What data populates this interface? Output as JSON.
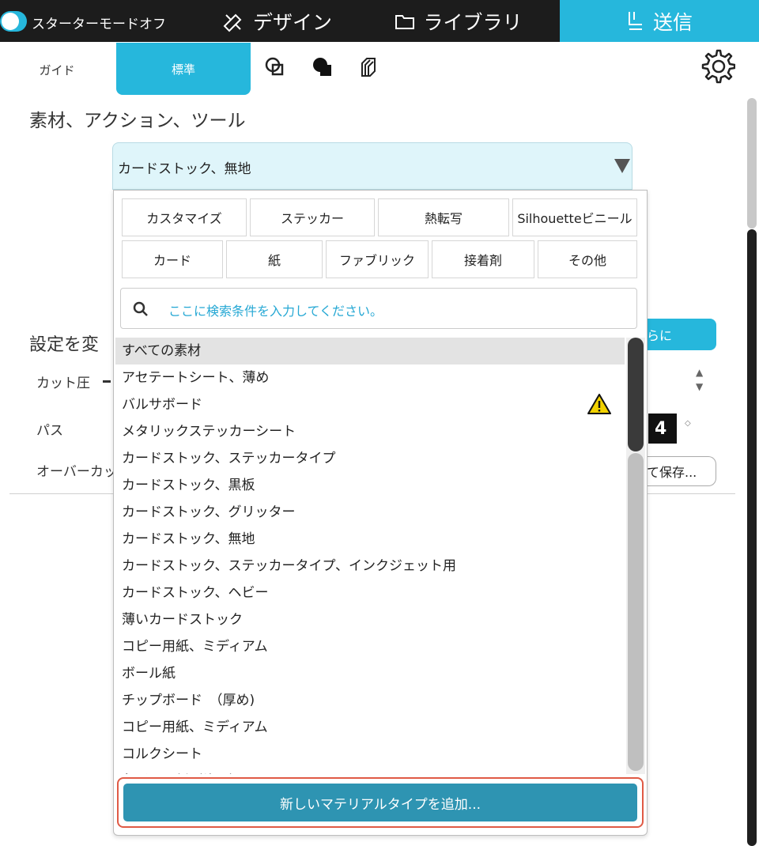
{
  "topbar": {
    "starter_label": "スターターモードオフ",
    "tab_design": "デザイン",
    "tab_library": "ライブラリ",
    "tab_send": "送信"
  },
  "subtabs": {
    "guide": "ガイド",
    "standard": "標準"
  },
  "section_title": "素材、アクション、ツール",
  "material_select": {
    "value": "カードストック、無地"
  },
  "background_panel": {
    "settings_label": "設定を変",
    "cut_pressure": "カット圧",
    "pass": "パス",
    "overcut": "オーバーカット",
    "further_button": "らに",
    "pass_value": "4",
    "save_button": "て保存..."
  },
  "dropdown": {
    "categories_row1": [
      "カスタマイズ",
      "ステッカー",
      "熱転写",
      "Silhouetteビニール"
    ],
    "categories_row2": [
      "カード",
      "紙",
      "ファブリック",
      "接着剤",
      "その他"
    ],
    "search_placeholder": "ここに検索条件を入力してください。",
    "items": [
      "すべての素材",
      "アセテートシート、薄め",
      "バルサボード",
      "メタリックステッカーシート",
      "カードストック、ステッカータイプ",
      "カードストック、黒板",
      "カードストック、グリッター",
      "カードストック、無地",
      "カードストック、ステッカータイプ、インクジェット用",
      "カードストック、ヘビー",
      "薄いカードストック",
      "コピー用紙、ミディアム",
      "ボール紙",
      "チップボード　（厚め)",
      "コピー用紙、ミディアム",
      "コルクシート",
      "段ボール紙（片面）"
    ],
    "add_button": "新しいマテリアルタイプを追加..."
  },
  "colors": {
    "accent": "#26b7dc",
    "topbar_bg": "#1c1c1c",
    "add_button_bg": "#2e94b2",
    "highlight_border": "#e05a45"
  }
}
